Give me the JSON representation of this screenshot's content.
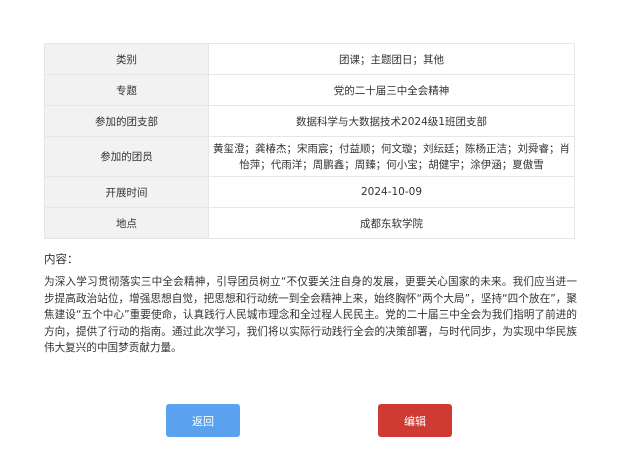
{
  "info": {
    "rows": [
      {
        "label": "类别",
        "value": "团课；主题团日；其他"
      },
      {
        "label": "专题",
        "value": "党的二十届三中全会精神"
      },
      {
        "label": "参加的团支部",
        "value": "数据科学与大数据技术2024级1班团支部"
      },
      {
        "label": "参加的团员",
        "value": "黄玺澄；龚椿杰；宋雨宸；付益顺；何文璇；刘纭廷；陈杨正洁；刘舜睿；肖怡萍；代雨洋；周鹏鑫；周臻；何小宝；胡健宇；涂伊涵；夏傲雪"
      },
      {
        "label": "开展时间",
        "value": "2024-10-09"
      },
      {
        "label": "地点",
        "value": "成都东软学院"
      }
    ]
  },
  "content": {
    "title": "内容：",
    "body": "为深入学习贯彻落实三中全会精神，引导团员树立“不仅要关注自身的发展，更要关心国家的未来。我们应当进一步提高政治站位，增强思想自觉，把思想和行动统一到全会精神上来，始终胸怀“两个大局”，坚持“四个放在”，聚焦建设“五个中心”重要使命，认真践行人民城市理念和全过程人民民主。党的二十届三中全会为我们指明了前进的方向，提供了行动的指南。通过此次学习，我们将以实际行动践行全会的决策部署，与时代同步，为实现中华民族伟大复兴的中国梦贡献力量。"
  },
  "actions": {
    "back_label": "返回",
    "edit_label": "编辑"
  },
  "colors": {
    "back_button": "#5aa2f0",
    "edit_button": "#cf3a32",
    "label_bg": "#f2f2f2",
    "border": "#e6e6e6"
  }
}
